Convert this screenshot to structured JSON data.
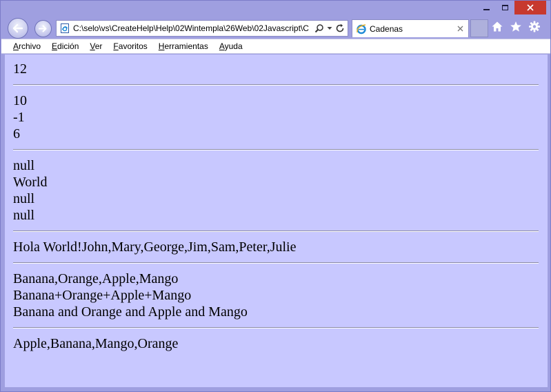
{
  "window": {
    "minimize_icon": "minimize-icon",
    "maximize_icon": "maximize-icon",
    "close_icon": "close-icon"
  },
  "nav": {
    "back_icon": "arrow-left-icon",
    "forward_icon": "arrow-right-icon",
    "address": "C:\\selo\\vs\\CreateHelp\\Help\\02Wintempla\\26Web\\02Javascript\\C",
    "search_icon": "search-icon",
    "refresh_icon": "refresh-icon"
  },
  "tab": {
    "title": "Cadenas",
    "icon": "ie-icon"
  },
  "toolbar_icons": [
    "home-icon",
    "star-icon",
    "gear-icon"
  ],
  "menu": [
    {
      "label": "Archivo",
      "key": "A",
      "rest": "rchivo"
    },
    {
      "label": "Edición",
      "key": "E",
      "rest": "dición"
    },
    {
      "label": "Ver",
      "key": "V",
      "rest": "er"
    },
    {
      "label": "Favoritos",
      "key": "F",
      "rest": "avoritos"
    },
    {
      "label": "Herramientas",
      "key": "H",
      "rest": "erramientas"
    },
    {
      "label": "Ayuda",
      "key": "A",
      "rest": "yuda"
    }
  ],
  "content": {
    "sections": [
      [
        "12"
      ],
      [
        "10",
        "-1",
        "6"
      ],
      [
        "null",
        "World",
        "null",
        "null"
      ],
      [
        "Hola World!John,Mary,George,Jim,Sam,Peter,Julie"
      ],
      [
        "Banana,Orange,Apple,Mango",
        "Banana+Orange+Apple+Mango",
        "Banana and Orange and Apple and Mango"
      ],
      [
        "Apple,Banana,Mango,Orange"
      ]
    ]
  },
  "colors": {
    "content_bg": "#c8c8ff",
    "frame_bg": "#9f9fe0",
    "close_red": "#c7392e"
  }
}
